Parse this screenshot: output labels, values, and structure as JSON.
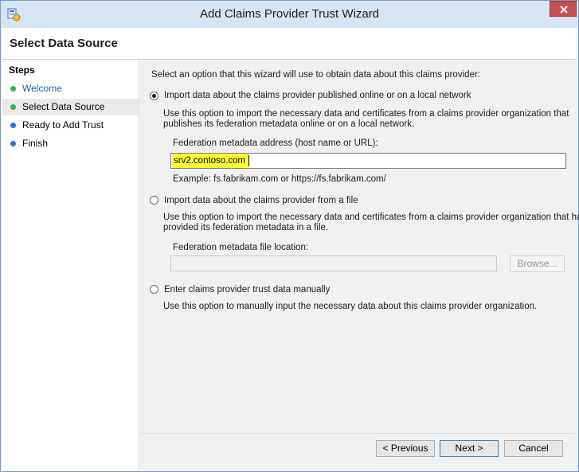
{
  "window": {
    "title": "Add Claims Provider Trust Wizard"
  },
  "header": {
    "title": "Select Data Source"
  },
  "steps": {
    "title": "Steps",
    "items": [
      {
        "label": "Welcome",
        "status": "completed",
        "color": "#3bb143",
        "text_color": "#1f5fb4"
      },
      {
        "label": "Select Data Source",
        "status": "current",
        "color": "#3bb143",
        "text_color": "#1e1e1e"
      },
      {
        "label": "Ready to Add Trust",
        "status": "pending",
        "color": "#2f6fd6",
        "text_color": "#1e1e1e"
      },
      {
        "label": "Finish",
        "status": "pending",
        "color": "#2f6fd6",
        "text_color": "#1e1e1e"
      }
    ]
  },
  "main": {
    "intro": "Select an option that this wizard will use to obtain data about this claims provider:",
    "option_online": {
      "label": "Import data about the claims provider published online or on a local network",
      "desc_line1": "Use this option to import the necessary data and certificates from a claims provider organization that",
      "desc_line2": "publishes its federation metadata online or on a local network.",
      "field_label": "Federation metadata address (host name or URL):",
      "field_value": "srv2.contoso.com",
      "example": "Example: fs.fabrikam.com or https://fs.fabrikam.com/",
      "selected": true
    },
    "option_file": {
      "label": "Import data about the claims provider from a file",
      "desc_line1": "Use this option to import the necessary data and certificates from a claims provider organization that has",
      "desc_line2": "provided its federation metadata in a file.",
      "field_label": "Federation metadata file location:",
      "browse_label": "Browse...",
      "selected": false
    },
    "option_manual": {
      "label": "Enter claims provider trust data manually",
      "desc": "Use this option to manually input the necessary data about this claims provider organization.",
      "selected": false
    }
  },
  "footer": {
    "previous_label": "< Previous",
    "next_label": "Next >",
    "cancel_label": "Cancel"
  },
  "colors": {
    "highlight": "#ffff33",
    "titlebar": "#d7e4f2",
    "close": "#c75050"
  }
}
